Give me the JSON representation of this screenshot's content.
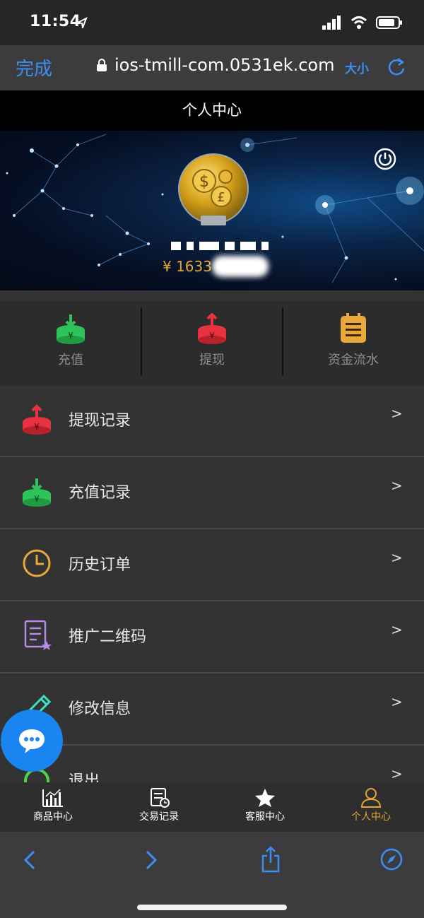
{
  "status_bar": {
    "time": "11:54"
  },
  "browser": {
    "done_label": "完成",
    "url": "ios-tmill-com.0531ek.com",
    "text_size_label": "大小"
  },
  "page": {
    "title": "个人中心"
  },
  "profile": {
    "balance_prefix": "¥ 1633"
  },
  "quick_actions": [
    {
      "label": "充值",
      "icon": "deposit-icon",
      "color": "#2fc45a"
    },
    {
      "label": "提现",
      "icon": "withdraw-icon",
      "color": "#e8323f"
    },
    {
      "label": "资金流水",
      "icon": "ledger-icon",
      "color": "#e9a83a"
    }
  ],
  "menu": [
    {
      "label": "提现记录",
      "icon": "withdraw-icon",
      "chevron": ">"
    },
    {
      "label": "充值记录",
      "icon": "deposit-icon",
      "chevron": ">"
    },
    {
      "label": "历史订单",
      "icon": "clock-icon",
      "chevron": ">"
    },
    {
      "label": "推广二维码",
      "icon": "document-star-icon",
      "chevron": ">"
    },
    {
      "label": "修改信息",
      "icon": "pencil-icon",
      "chevron": ">"
    },
    {
      "label": "退出",
      "icon": "logout-icon",
      "chevron": ">"
    }
  ],
  "tabs": [
    {
      "label": "商品中心",
      "icon": "chart-icon",
      "active": false
    },
    {
      "label": "交易记录",
      "icon": "record-icon",
      "active": false
    },
    {
      "label": "客服中心",
      "icon": "star-icon",
      "active": false
    },
    {
      "label": "个人中心",
      "icon": "person-icon",
      "active": true
    }
  ],
  "colors": {
    "accent_blue": "#3d8ef2",
    "gold": "#e6a630",
    "background": "#333333"
  }
}
